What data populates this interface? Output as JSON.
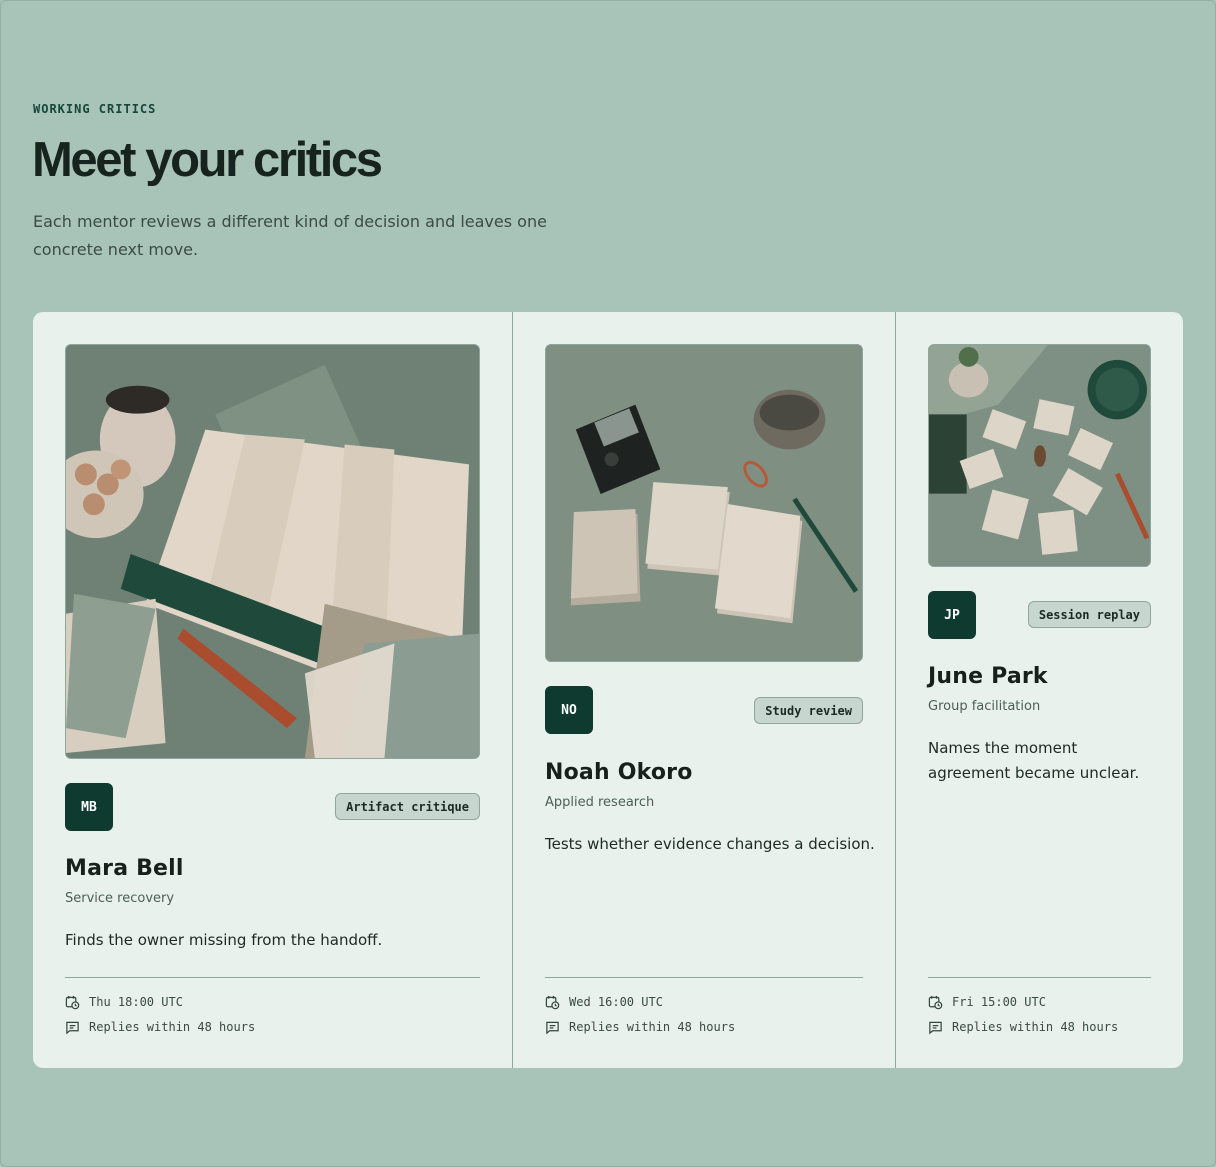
{
  "header": {
    "eyebrow": "WORKING CRITICS",
    "title": "Meet your critics",
    "subtitle": "Each mentor reviews a different kind of decision and leaves one concrete next move."
  },
  "mentors": [
    {
      "initials": "MB",
      "badge": "Artifact critique",
      "name": "Mara Bell",
      "role": "Service recovery",
      "blurb": "Finds the owner missing from the handoff.",
      "schedule": "Thu 18:00 UTC",
      "reply": "Replies within 48 hours",
      "photo_icon": "desk-still-life-photo"
    },
    {
      "initials": "NO",
      "badge": "Study review",
      "name": "Noah Okoro",
      "role": "Applied research",
      "blurb": "Tests whether evidence changes a decision.",
      "schedule": "Wed 16:00 UTC",
      "reply": "Replies within 48 hours",
      "photo_icon": "recorder-and-cards-photo"
    },
    {
      "initials": "JP",
      "badge": "Session replay",
      "name": "June Park",
      "role": "Group facilitation",
      "blurb": "Names the moment agreement became unclear.",
      "schedule": "Fri 15:00 UTC",
      "reply": "Replies within 48 hours",
      "photo_icon": "cards-and-clock-photo"
    }
  ],
  "colors": {
    "page_bg": "#a8c3b7",
    "panel_bg": "#e8f1ec",
    "accent": "#0e3a30",
    "badge_bg": "#c7d6ce"
  }
}
